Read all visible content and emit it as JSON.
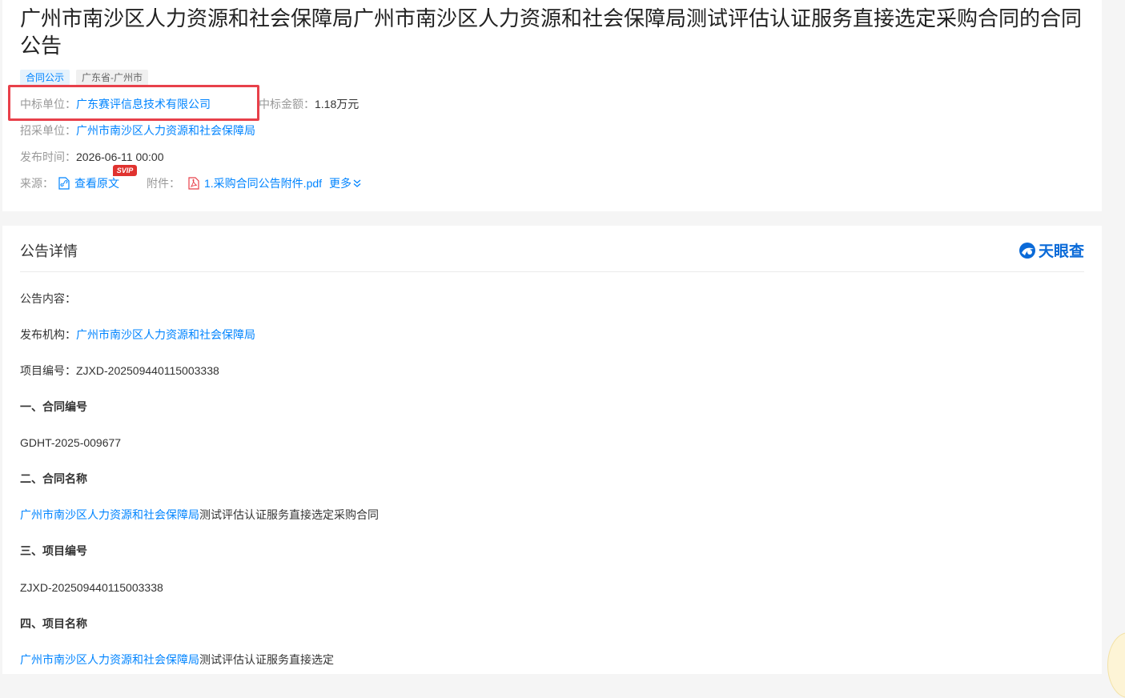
{
  "header": {
    "title": "广州市南沙区人力资源和社会保障局广州市南沙区人力资源和社会保障局测试评估认证服务直接选定采购合同的合同公告",
    "tags": [
      "合同公示",
      "广东省-广州市"
    ]
  },
  "info": {
    "winner_label": "中标单位：",
    "winner_value": "广东赛评信息技术有限公司",
    "amount_label": "中标金额：",
    "amount_value": "1.18万元",
    "buyer_label": "招采单位：",
    "buyer_value": "广州市南沙区人力资源和社会保障局",
    "publish_label": "发布时间：",
    "publish_value": "2026-06-11 00:00",
    "source_label": "来源：",
    "source_link": "查看原文",
    "svip_badge": "SVIP",
    "attachment_label": "附件：",
    "attachment_file": "1.采购合同公告附件.pdf",
    "more_label": "更多"
  },
  "detail": {
    "section_title": "公告详情",
    "brand_name": "天眼查",
    "content_label": "公告内容：",
    "publisher_label": "发布机构：",
    "publisher_value": "广州市南沙区人力资源和社会保障局",
    "project_no_label": "项目编号：",
    "project_no_value": "ZJXD-202509440115003338",
    "h1": "一、合同编号",
    "contract_no": "GDHT-2025-009677",
    "h2": "二、合同名称",
    "contract_name_link": "广州市南沙区人力资源和社会保障局",
    "contract_name_rest": "测试评估认证服务直接选定采购合同",
    "h3": "三、项目编号",
    "project_no_2": "ZJXD-202509440115003338",
    "h4": "四、项目名称",
    "project_name_link": "广州市南沙区人力资源和社会保障局",
    "project_name_rest": "测试评估认证服务直接选定"
  },
  "colors": {
    "link": "#0084ff",
    "highlight_border": "#e8404a",
    "brand": "#0a6ad8"
  }
}
